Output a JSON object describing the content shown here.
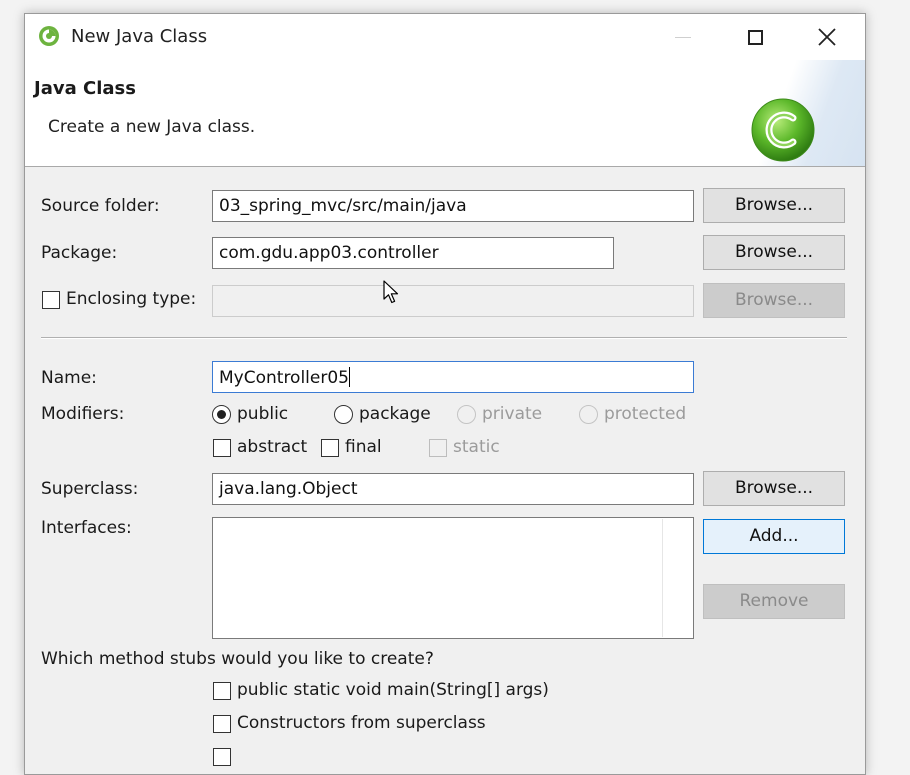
{
  "window": {
    "title": "New Java Class"
  },
  "header": {
    "title": "Java Class",
    "description": "Create a new Java class."
  },
  "form": {
    "source_folder": {
      "label": "Source folder:",
      "value": "03_spring_mvc/src/main/java",
      "button": "Browse..."
    },
    "package": {
      "label": "Package:",
      "value": "com.gdu.app03.controller",
      "button": "Browse..."
    },
    "enclosing_type": {
      "label": "Enclosing type:",
      "value": "",
      "button": "Browse...",
      "checked": false
    },
    "name": {
      "label": "Name:",
      "value": "MyController05"
    },
    "modifiers": {
      "label": "Modifiers:",
      "radios": [
        "public",
        "package",
        "private",
        "protected"
      ],
      "selected": "public",
      "checkboxes": [
        "abstract",
        "final",
        "static"
      ]
    },
    "superclass": {
      "label": "Superclass:",
      "value": "java.lang.Object",
      "button": "Browse..."
    },
    "interfaces": {
      "label": "Interfaces:",
      "add_button": "Add...",
      "remove_button": "Remove"
    },
    "method_stubs": {
      "question": "Which method stubs would you like to create?",
      "options": [
        "public static void main(String[] args)",
        "Constructors from superclass"
      ]
    }
  },
  "colors": {
    "focus_border": "#3b7bd4",
    "button_focus_bg": "#e5f1fb",
    "icon_green": "#5cb82a"
  }
}
